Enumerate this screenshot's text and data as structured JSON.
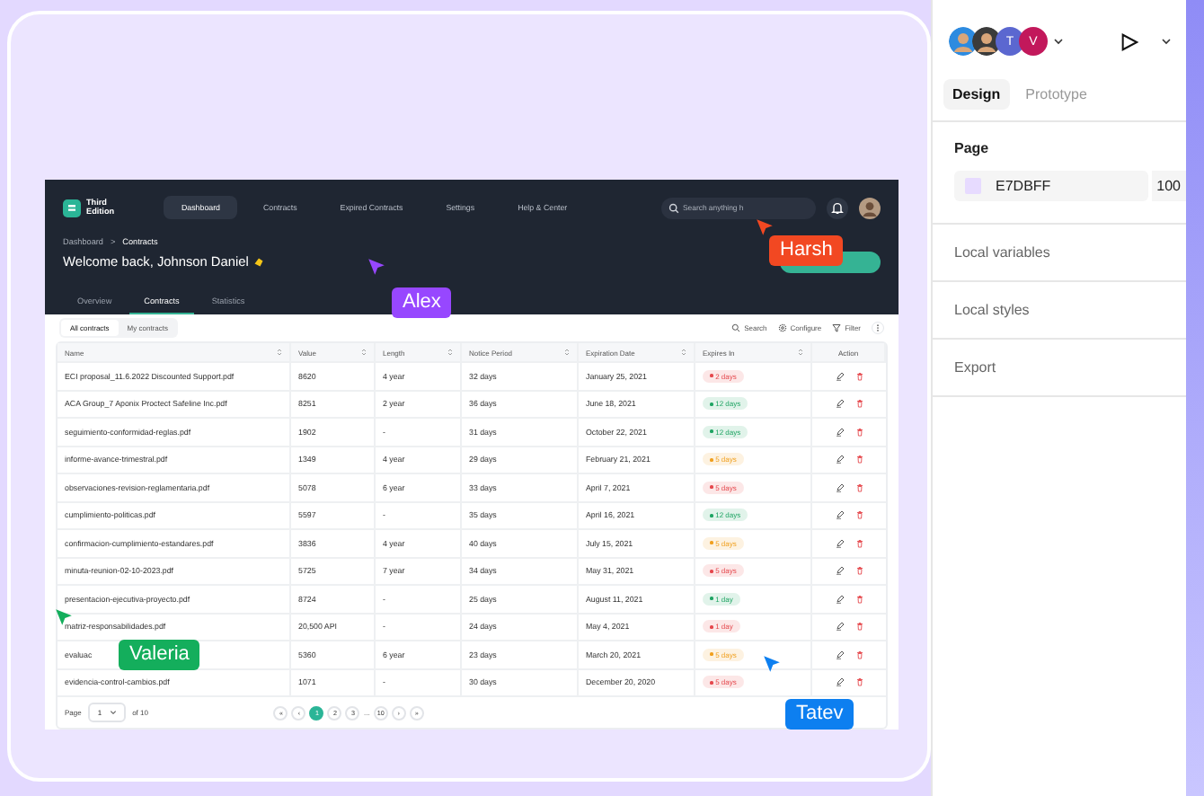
{
  "dashboard": {
    "brand": {
      "line_1": "Third",
      "line_2": "Edition"
    },
    "nav": [
      {
        "label": "Dashboard",
        "selected": true
      },
      {
        "label": "Contracts",
        "selected": false
      },
      {
        "label": "Expired Contracts",
        "selected": false
      },
      {
        "label": "Settings",
        "selected": false
      },
      {
        "label": "Help & Center",
        "selected": false
      }
    ],
    "search": {
      "placeholder": "Search anything h"
    },
    "breadcrumb": {
      "items": [
        "Dashboard",
        "Contracts"
      ],
      "separator": ">"
    },
    "welcome": "Welcome back, Johnson Daniel",
    "tabs": [
      {
        "label": "Overview",
        "selected": false
      },
      {
        "label": "Contracts",
        "selected": true
      },
      {
        "label": "Statistics",
        "selected": false
      }
    ],
    "segments": [
      {
        "label": "All contracts",
        "selected": true
      },
      {
        "label": "My contracts",
        "selected": false
      }
    ],
    "tools": [
      {
        "kind": "search",
        "label": "Search"
      },
      {
        "kind": "configure",
        "label": "Configure"
      },
      {
        "kind": "filter",
        "label": "Filter"
      }
    ],
    "table": {
      "columns": [
        {
          "label": "Name",
          "sortable": true
        },
        {
          "label": "Value",
          "sortable": true
        },
        {
          "label": "Length",
          "sortable": true
        },
        {
          "label": "Notice Period",
          "sortable": true
        },
        {
          "label": "Expiration Date",
          "sortable": true
        },
        {
          "label": "Expires In",
          "sortable": true
        },
        {
          "label": "Action",
          "sortable": false
        }
      ],
      "rows": [
        {
          "name": "ECI proposal_11.6.2022 Discounted Support.pdf",
          "value": "8620",
          "length": "4 year",
          "notice": "32 days",
          "expiration": "January 25, 2021",
          "expires_in": "2 days",
          "color": "#e5484d"
        },
        {
          "name": "ACA Group_7 Aponix Proctect Safeline Inc.pdf",
          "value": "8251",
          "length": "2 year",
          "notice": "36 days",
          "expiration": "June 18, 2021",
          "expires_in": "12 days",
          "color": "#1fa463"
        },
        {
          "name": "seguimiento-conformidad-reglas.pdf",
          "value": "1902",
          "length": "-",
          "notice": "31 days",
          "expiration": "October 22, 2021",
          "expires_in": "12 days",
          "color": "#1fa463"
        },
        {
          "name": "informe-avance-trimestral.pdf",
          "value": "1349",
          "length": "4 year",
          "notice": "29 days",
          "expiration": "February 21, 2021",
          "expires_in": "5 days",
          "color": "#f0a020"
        },
        {
          "name": "observaciones-revision-reglamentaria.pdf",
          "value": "5078",
          "length": "6 year",
          "notice": "33 days",
          "expiration": "April 7, 2021",
          "expires_in": "5 days",
          "color": "#e5484d"
        },
        {
          "name": "cumplimiento-politicas.pdf",
          "value": "5597",
          "length": "-",
          "notice": "35 days",
          "expiration": "April 16, 2021",
          "expires_in": "12 days",
          "color": "#1fa463"
        },
        {
          "name": "confirmacion-cumplimiento-estandares.pdf",
          "value": "3836",
          "length": "4 year",
          "notice": "40 days",
          "expiration": "July 15, 2021",
          "expires_in": "5 days",
          "color": "#f0a020"
        },
        {
          "name": "minuta-reunion-02-10-2023.pdf",
          "value": "5725",
          "length": "7 year",
          "notice": "34 days",
          "expiration": "May 31, 2021",
          "expires_in": "5 days",
          "color": "#e5484d"
        },
        {
          "name": "presentacion-ejecutiva-proyecto.pdf",
          "value": "8724",
          "length": "-",
          "notice": "25 days",
          "expiration": "August 11, 2021",
          "expires_in": "1 day",
          "color": "#1fa463"
        },
        {
          "name": "matriz-responsabilidades.pdf",
          "value": "20,500 API",
          "length": "-",
          "notice": "24 days",
          "expiration": "May 4, 2021",
          "expires_in": "1 day",
          "color": "#e5484d"
        },
        {
          "name": "evaluac",
          "value": "5360",
          "length": "6 year",
          "notice": "23 days",
          "expiration": "March 20, 2021",
          "expires_in": "5 days",
          "color": "#f0a020"
        },
        {
          "name": "evidencia-control-cambios.pdf",
          "value": "1071",
          "length": "-",
          "notice": "30 days",
          "expiration": "December 20, 2020",
          "expires_in": "5 days",
          "color": "#e5484d"
        }
      ]
    },
    "pagination": {
      "label": "Page",
      "current": "1",
      "total": "of 10",
      "pages": [
        {
          "kind": "arrow",
          "label": "«",
          "selected": false
        },
        {
          "kind": "arrow",
          "label": "‹",
          "selected": false
        },
        {
          "kind": "page",
          "label": "1",
          "selected": true
        },
        {
          "kind": "page",
          "label": "2",
          "selected": false
        },
        {
          "kind": "page",
          "label": "3",
          "selected": false
        },
        {
          "kind": "gap",
          "label": "..."
        },
        {
          "kind": "page",
          "label": "10",
          "selected": false
        },
        {
          "kind": "arrow",
          "label": "›",
          "selected": false
        },
        {
          "kind": "arrow",
          "label": "»",
          "selected": false
        }
      ]
    }
  },
  "cursors": [
    {
      "name": "Harsh",
      "color": "#f24822"
    },
    {
      "name": "Alex",
      "color": "#9747ff"
    },
    {
      "name": "Valeria",
      "color": "#14ae5c"
    },
    {
      "name": "Tatev",
      "color": "#0d7ff0"
    }
  ],
  "panel": {
    "avatars": [
      {
        "kind": "photo",
        "color": "#2d8be0"
      },
      {
        "kind": "photo",
        "color": "#3b3b3b"
      },
      {
        "kind": "initial",
        "letter": "T",
        "color": "#5b67d0"
      },
      {
        "kind": "initial",
        "letter": "V",
        "color": "#c2185b"
      }
    ],
    "tabs": [
      {
        "label": "Design",
        "selected": true
      },
      {
        "label": "Prototype",
        "selected": false
      }
    ],
    "page": {
      "title": "Page",
      "hex": "E7DBFF",
      "opacity": "100"
    },
    "sections": [
      "Local variables",
      "Local styles",
      "Export"
    ]
  }
}
